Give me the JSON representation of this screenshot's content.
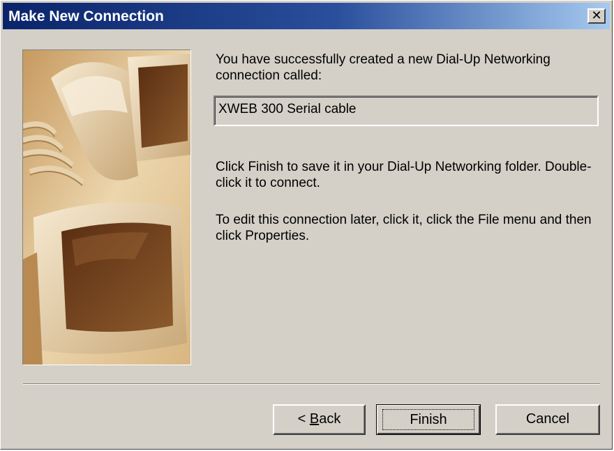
{
  "window": {
    "title": "Make New Connection",
    "close_glyph": "✕"
  },
  "content": {
    "intro_text": "You have successfully created a new Dial-Up Networking connection called:",
    "connection_name": "XWEB 300 Serial cable",
    "finish_text": "Click Finish to save it in your Dial-Up Networking folder. Double-click it to connect.",
    "edit_text": "To edit this connection later, click it, click the File menu and then click Properties."
  },
  "buttons": {
    "back_prefix": "< ",
    "back_mnemonic": "B",
    "back_rest": "ack",
    "finish_label": "Finish",
    "cancel_label": "Cancel"
  },
  "colors": {
    "face": "#d4d0c8",
    "title_start": "#0a246a",
    "title_end": "#a6caf0",
    "illustration_tone": "#c89a5a"
  },
  "icons": {
    "close": "close-icon",
    "illustration": "phone-and-monitor-illustration"
  }
}
